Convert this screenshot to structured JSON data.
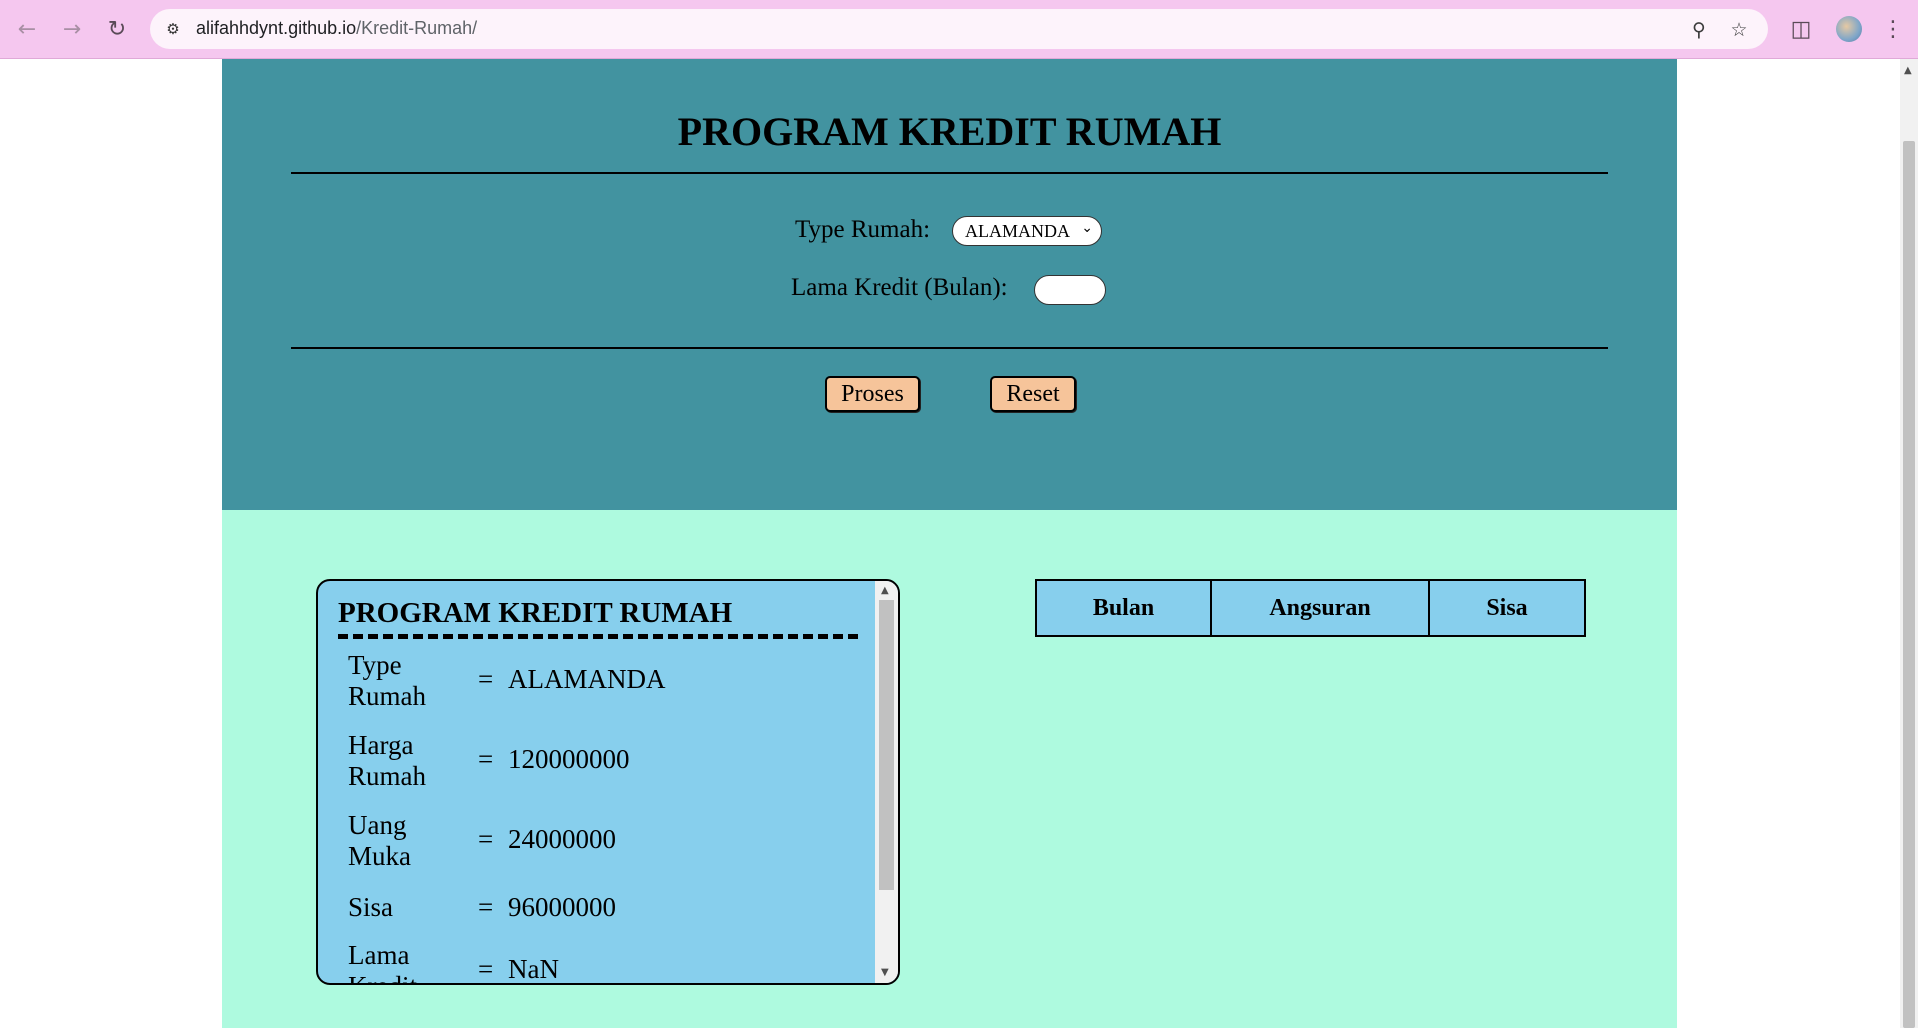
{
  "browser": {
    "url_host": "alifahhdynt.github.io",
    "url_path": "/Kredit-Rumah/",
    "icons": {
      "back": "back-arrow-icon",
      "forward": "forward-arrow-icon",
      "reload": "reload-icon",
      "site_info": "tune-icon",
      "zoom": "zoom-icon",
      "bookmark": "star-icon",
      "side_panel": "side-panel-icon",
      "menu": "kebab-menu-icon"
    }
  },
  "form": {
    "title": "PROGRAM KREDIT RUMAH",
    "type_label": "Type Rumah:",
    "type_selected": "ALAMANDA",
    "lama_label": "Lama Kredit (Bulan):",
    "lama_value": "",
    "proses_label": "Proses",
    "reset_label": "Reset"
  },
  "result": {
    "title": "PROGRAM KREDIT RUMAH",
    "rows": [
      {
        "key": "Type Rumah",
        "eq": "=",
        "value": "ALAMANDA"
      },
      {
        "key": "Harga Rumah",
        "eq": "=",
        "value": "120000000"
      },
      {
        "key": "Uang Muka",
        "eq": "=",
        "value": "24000000"
      },
      {
        "key": "Sisa",
        "eq": "=",
        "value": "96000000"
      },
      {
        "key": "Lama Kredit",
        "eq": "=",
        "value": "NaN"
      }
    ]
  },
  "table": {
    "headers": [
      "Bulan",
      "Angsuran",
      "Sisa"
    ]
  },
  "colors": {
    "chrome": "#f5c7ef",
    "top_section": "#4293a0",
    "bottom_section": "#aefadf",
    "card": "#87cfed",
    "button": "#f6c49a"
  }
}
